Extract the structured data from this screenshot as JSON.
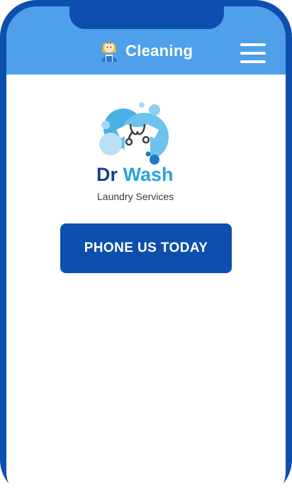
{
  "header": {
    "title": "Cleaning",
    "avatar_icon": "cleaner-avatar-icon",
    "menu_icon": "hamburger-menu-icon"
  },
  "logo": {
    "brand_part1": "Dr",
    "brand_part2": "Wash",
    "subtitle": "Laundry Services",
    "icon": "laundry-shirt-bubbles-icon"
  },
  "cta": {
    "label": "PHONE US TODAY"
  },
  "colors": {
    "frame": "#0d4fae",
    "header": "#4ea0eb",
    "button": "#0d4fae",
    "brand_dark": "#1a3f8c",
    "brand_light": "#29a3de"
  }
}
